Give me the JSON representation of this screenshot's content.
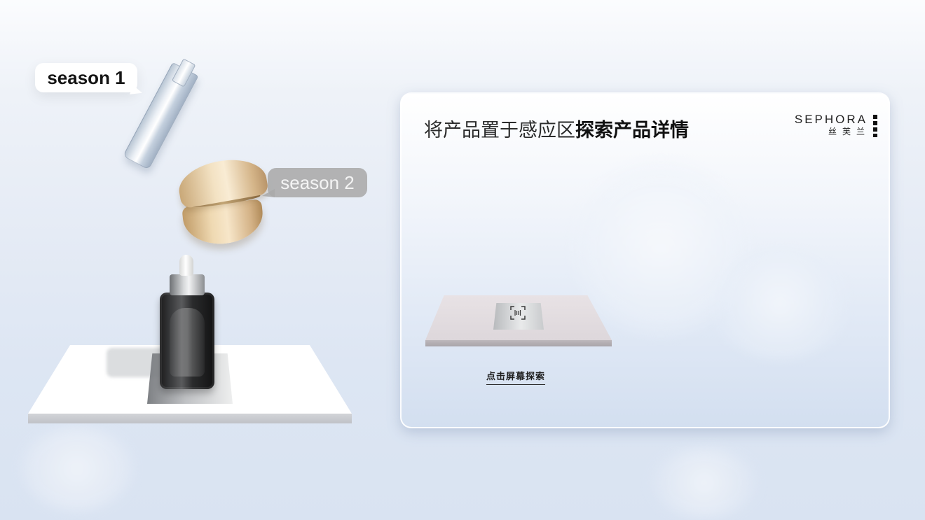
{
  "scene": {
    "callouts": [
      {
        "label": "season 1"
      },
      {
        "label": "season 2"
      }
    ],
    "products": [
      {
        "name": "glass-serum-vial"
      },
      {
        "name": "cream-jar"
      },
      {
        "name": "dropper-bottle"
      }
    ]
  },
  "panel": {
    "title_regular": "将产品置于感应区",
    "title_bold": "探索产品详情",
    "brand": {
      "name": "SEPHORA",
      "chinese": "丝芙兰"
    },
    "cta_label": "点击屏幕探索",
    "scan_icon": "scan-frame-icon"
  },
  "colors": {
    "accent": "#111111",
    "callout_primary_bg": "#ffffff",
    "callout_secondary_bg": "#aaaaaa",
    "panel_bg_top": "#ffffff",
    "panel_bg_bottom": "#d3dff0"
  }
}
